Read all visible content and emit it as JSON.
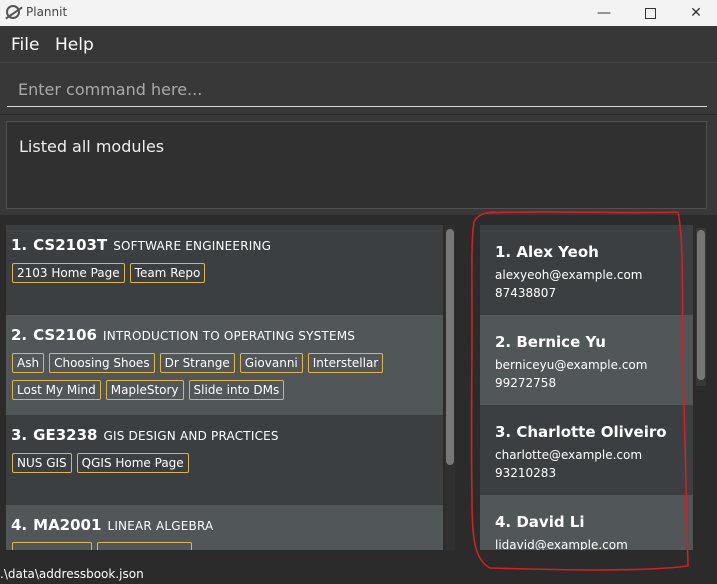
{
  "window": {
    "title": "Plannit",
    "min_glyph": "—",
    "close_glyph": "✕"
  },
  "menu": {
    "file": "File",
    "help": "Help"
  },
  "command": {
    "placeholder": "Enter command here...",
    "value": ""
  },
  "result": {
    "text": "Listed all modules"
  },
  "modules": [
    {
      "index": "1.",
      "code": "CS2103T",
      "name": "SOFTWARE ENGINEERING",
      "tags": [
        "2103 Home Page",
        "Team Repo"
      ]
    },
    {
      "index": "2.",
      "code": "CS2106",
      "name": "INTRODUCTION TO OPERATING SYSTEMS",
      "tags": [
        "Ash",
        "Choosing Shoes",
        "Dr Strange",
        "Giovanni",
        "Interstellar",
        "Lost My Mind",
        "MapleStory",
        "Slide into DMs"
      ]
    },
    {
      "index": "3.",
      "code": "GE3238",
      "name": "GIS DESIGN AND PRACTICES",
      "tags": [
        "NUS GIS",
        "QGIS Home Page"
      ]
    },
    {
      "index": "4.",
      "code": "MA2001",
      "name": "LINEAR ALGEBRA",
      "tags": [
        "",
        ""
      ]
    }
  ],
  "persons": [
    {
      "name": "1.  Alex Yeoh",
      "email": "alexyeoh@example.com",
      "phone": "87438807"
    },
    {
      "name": "2.  Bernice Yu",
      "email": "berniceyu@example.com",
      "phone": "99272758"
    },
    {
      "name": "3.  Charlotte Oliveiro",
      "email": "charlotte@example.com",
      "phone": "93210283"
    },
    {
      "name": "4.  David Li",
      "email": "lidavid@example.com",
      "phone": ""
    }
  ],
  "status": {
    "path": ".\\data\\addressbook.json"
  },
  "colors": {
    "tag_border": "#e0b44a",
    "annotation": "#d42020"
  }
}
